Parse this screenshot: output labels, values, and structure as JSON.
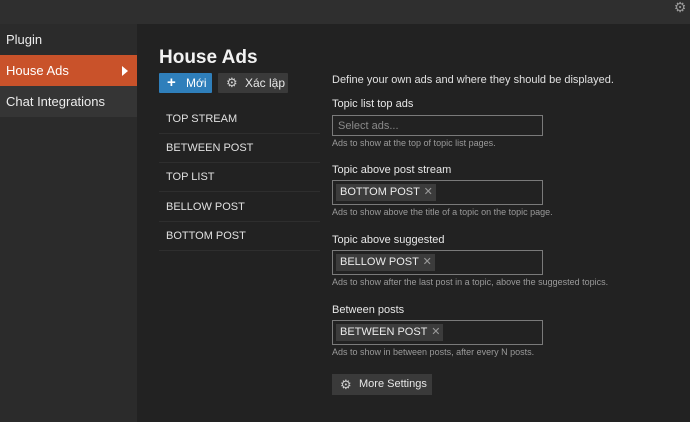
{
  "sidebar": {
    "items": [
      {
        "label": "Plugin"
      },
      {
        "label": "House Ads"
      },
      {
        "label": "Chat Integrations"
      }
    ]
  },
  "main": {
    "title": "House Ads",
    "new_button": "Mới",
    "settings_button": "Xác lập",
    "description": "Define your own ads and where they should be displayed.",
    "more_settings": "More Settings"
  },
  "ads": [
    "TOP STREAM",
    "BETWEEN POST",
    "TOP LIST",
    "BELLOW POST",
    "BOTTOM POST"
  ],
  "fields": [
    {
      "label": "Topic list top ads",
      "placeholder": "Select ads...",
      "help": "Ads to show at the top of topic list pages."
    },
    {
      "label": "Topic above post stream",
      "value": "BOTTOM POST",
      "help": "Ads to show above the title of a topic on the topic page."
    },
    {
      "label": "Topic above suggested",
      "value": "BELLOW POST",
      "help": "Ads to show after the last post in a topic, above the suggested topics."
    },
    {
      "label": "Between posts",
      "value": "BETWEEN POST",
      "help": "Ads to show in between posts, after every N posts."
    }
  ],
  "icons": {
    "settings": "gear-icon",
    "new": "plus-icon",
    "remove": "close-icon",
    "active": "chevron-right-icon"
  },
  "colors": {
    "accent": "#c9522a",
    "primary": "#2f7fbb",
    "background": "#222222"
  }
}
